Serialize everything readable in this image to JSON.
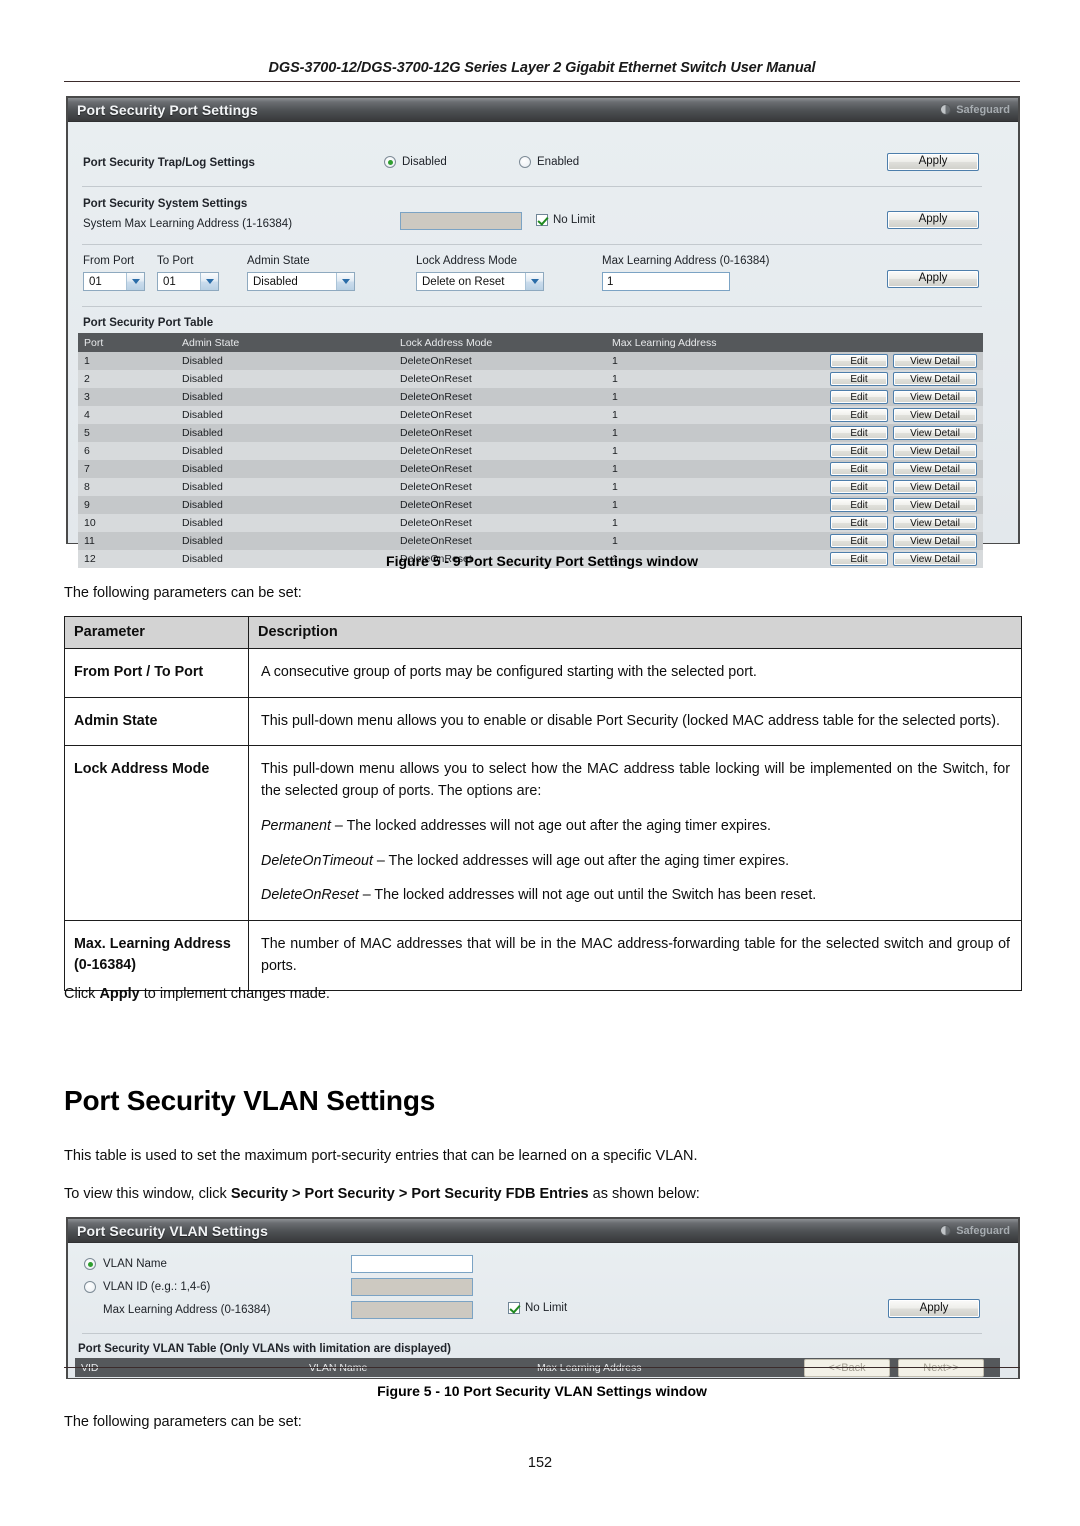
{
  "document": {
    "header_title": "DGS-3700-12/DGS-3700-12G Series Layer 2 Gigabit Ethernet Switch User Manual",
    "page_number": "152"
  },
  "port_settings_window": {
    "title": "Port Security Port Settings",
    "safeguard_label": "Safeguard",
    "trap_log": {
      "label": "Port Security Trap/Log Settings",
      "option_disabled": "Disabled",
      "option_enabled": "Enabled",
      "selected": "Disabled",
      "apply_label": "Apply"
    },
    "system_settings": {
      "section_label": "Port Security System Settings",
      "max_learning_label": "System Max Learning Address (1-16384)",
      "max_learning_value": "",
      "no_limit_label": "No Limit",
      "no_limit_checked": true,
      "apply_label": "Apply"
    },
    "port_config": {
      "from_port_label": "From Port",
      "from_port_value": "01",
      "to_port_label": "To Port",
      "to_port_value": "01",
      "admin_state_label": "Admin State",
      "admin_state_value": "Disabled",
      "lock_mode_label": "Lock Address Mode",
      "lock_mode_value": "Delete on Reset",
      "max_learning_label": "Max Learning Address (0-16384)",
      "max_learning_value": "1",
      "apply_label": "Apply"
    },
    "port_table": {
      "caption": "Port Security Port Table",
      "columns": [
        "Port",
        "Admin State",
        "Lock Address Mode",
        "Max Learning Address"
      ],
      "edit_label": "Edit",
      "view_detail_label": "View Detail",
      "rows": [
        [
          "1",
          "Disabled",
          "DeleteOnReset",
          "1"
        ],
        [
          "2",
          "Disabled",
          "DeleteOnReset",
          "1"
        ],
        [
          "3",
          "Disabled",
          "DeleteOnReset",
          "1"
        ],
        [
          "4",
          "Disabled",
          "DeleteOnReset",
          "1"
        ],
        [
          "5",
          "Disabled",
          "DeleteOnReset",
          "1"
        ],
        [
          "6",
          "Disabled",
          "DeleteOnReset",
          "1"
        ],
        [
          "7",
          "Disabled",
          "DeleteOnReset",
          "1"
        ],
        [
          "8",
          "Disabled",
          "DeleteOnReset",
          "1"
        ],
        [
          "9",
          "Disabled",
          "DeleteOnReset",
          "1"
        ],
        [
          "10",
          "Disabled",
          "DeleteOnReset",
          "1"
        ],
        [
          "11",
          "Disabled",
          "DeleteOnReset",
          "1"
        ],
        [
          "12",
          "Disabled",
          "DeleteOnReset",
          "1"
        ]
      ]
    }
  },
  "figure_5_9_caption": "Figure 5 - 9 Port Security Port Settings window",
  "intro_1": "The following parameters can be set:",
  "parameters_table": {
    "col_parameter": "Parameter",
    "col_description": "Description",
    "rows": [
      {
        "name": "From Port / To Port",
        "desc": [
          "A consecutive group of ports may be configured starting with the selected port."
        ]
      },
      {
        "name": "Admin State",
        "desc": [
          "This pull-down menu allows you to enable or disable Port Security (locked MAC address table for the selected ports)."
        ]
      },
      {
        "name": "Lock Address Mode",
        "desc": [
          "This pull-down menu allows you to select how the MAC address table locking will be implemented on the Switch, for the selected group of ports. The options are:",
          "Permanent – The locked addresses will not age out after the aging timer expires.",
          "DeleteOnTimeout – The locked addresses will age out after the aging timer expires.",
          "DeleteOnReset – The locked addresses will not age out until the Switch has been reset."
        ]
      },
      {
        "name": "Max. Learning Address (0-16384)",
        "desc": [
          "The number of MAC addresses that will be in the MAC address-forwarding table for the selected switch and group of ports."
        ]
      }
    ]
  },
  "click_apply_note": {
    "prefix": "Click ",
    "bold": "Apply",
    "suffix": " to implement changes made."
  },
  "vlan_section": {
    "heading": "Port Security VLAN Settings",
    "intro": "This table is used to set the maximum port-security entries that can be learned on a specific VLAN.",
    "path_prefix": "To view this window, click ",
    "path_bold": "Security > Port Security > Port Security FDB Entries",
    "path_suffix": " as shown below:"
  },
  "vlan_window": {
    "title": "Port Security VLAN Settings",
    "safeguard_label": "Safeguard",
    "vlan_name_label": "VLAN Name",
    "vlan_name_value": "",
    "vlan_name_selected": true,
    "vlan_id_label": "VLAN ID (e.g.: 1,4-6)",
    "vlan_id_value": "",
    "max_learning_label": "Max Learning Address (0-16384)",
    "max_learning_value": "",
    "no_limit_label": "No Limit",
    "no_limit_checked": true,
    "apply_label": "Apply",
    "table_caption": "Port Security VLAN Table (Only VLANs with limitation are displayed)",
    "columns": [
      "VID",
      "VLAN Name",
      "Max Learning Address"
    ],
    "rows": [],
    "back_label": "<<Back",
    "next_label": "Next>>"
  },
  "figure_5_10_caption": "Figure 5 - 10 Port Security VLAN Settings window",
  "intro_2": "The following parameters can be set:"
}
